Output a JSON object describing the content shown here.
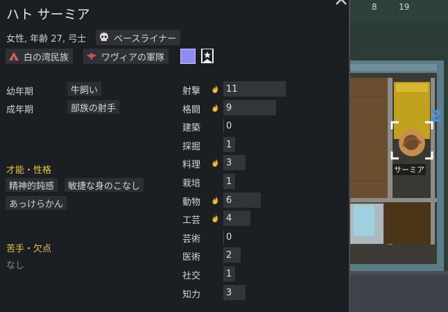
{
  "header": {
    "title": "ハト サーミア",
    "close_icon": "close-icon"
  },
  "info": {
    "gender_age_title": "女性, 年齢 27, 弓士",
    "xenotype": "ベースライナー",
    "xenotype_icon": "skull-icon"
  },
  "factions": {
    "faction_1": {
      "name": "白の湾民族",
      "icon": "tent-icon"
    },
    "faction_2": {
      "name": "ワヴィアの軍隊",
      "icon": "eagle-icon"
    },
    "color_swatch": "#8f8cf6",
    "favorite_icon": "star-icon"
  },
  "backstory": [
    {
      "label": "幼年期",
      "value": "牛飼い"
    },
    {
      "label": "成年期",
      "value": "部族の射手"
    }
  ],
  "traits": {
    "heading": "才能・性格",
    "items": [
      "精神的鈍感",
      "敏捷な身のこなし",
      "あっけらかん"
    ]
  },
  "incapable": {
    "heading": "苦手・欠点",
    "value": "なし"
  },
  "skills": [
    {
      "name": "射撃",
      "level": 11,
      "passion": true
    },
    {
      "name": "格闘",
      "level": 9,
      "passion": true
    },
    {
      "name": "建築",
      "level": 0,
      "passion": false
    },
    {
      "name": "採掘",
      "level": 1,
      "passion": false
    },
    {
      "name": "料理",
      "level": 3,
      "passion": true
    },
    {
      "name": "栽培",
      "level": 1,
      "passion": false
    },
    {
      "name": "動物",
      "level": 6,
      "passion": true
    },
    {
      "name": "工芸",
      "level": 4,
      "passion": true
    },
    {
      "name": "芸術",
      "level": 0,
      "passion": false
    },
    {
      "name": "医術",
      "level": 2,
      "passion": false
    },
    {
      "name": "社交",
      "level": 1,
      "passion": false
    },
    {
      "name": "知力",
      "level": 3,
      "passion": false
    }
  ],
  "skill_max": 20,
  "map": {
    "counter_1": "8",
    "counter_2": "19",
    "pawn_name": "サーミア"
  },
  "colors": {
    "passion_flame": "#e8a42a",
    "heading_gold": "#e9c73c",
    "panel_bg": "#1b1e22"
  }
}
